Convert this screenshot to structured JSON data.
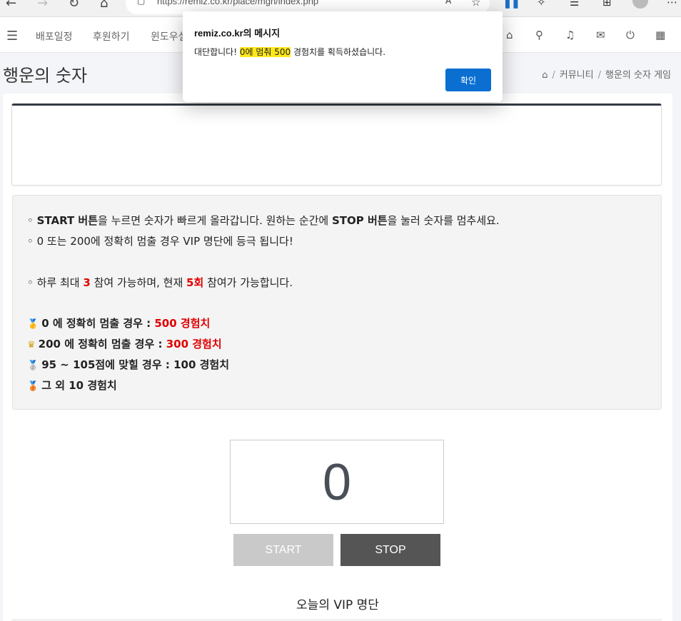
{
  "browser": {
    "url": "https://remiz.co.kr/place/mgn/index.php"
  },
  "nav": {
    "items": [
      "배포일정",
      "후원하기",
      "윈도우설"
    ]
  },
  "page": {
    "title": "행운의 숫자",
    "breadcrumb": [
      "커뮤니티",
      "행운의 숫자 게임"
    ]
  },
  "info": {
    "line1_a": "◦ ",
    "line1_b": "START 버튼",
    "line1_c": "을 누르면 숫자가 빠르게 올라갑니다. 원하는 순간에 ",
    "line1_d": "STOP 버튼",
    "line1_e": "을 눌러 숫자를 멈추세요.",
    "line2": "◦ 0 또는 200에 정확히 멈출 경우 VIP 명단에 등극 됩니다!",
    "line3_a": "◦ 하루 최대 ",
    "line3_b": "3",
    "line3_c": " 참여 가능하며, 현재 ",
    "line3_d": "5회",
    "line3_e": " 참여가 가능합니다.",
    "reward1_a": "0 에 정확히 멈출 경우 : ",
    "reward1_b": "500 경험치",
    "reward2_a": "200 에 정확히 멈출 경우 : ",
    "reward2_b": "300 경험치",
    "reward3": "95 ~ 105점에 맞힐 경우 : 100 경험치",
    "reward4": "그 외 10 경험치"
  },
  "game": {
    "number": "0",
    "start_label": "START",
    "stop_label": "STOP",
    "vip_title": "오늘의 VIP 명단"
  },
  "dialog": {
    "title": "remiz.co.kr의 메시지",
    "msg_a": "대단합니다! ",
    "msg_b": "0에 멈춰 500",
    "msg_c": " 경험치를 획득하셨습니다.",
    "ok_label": "확인"
  }
}
